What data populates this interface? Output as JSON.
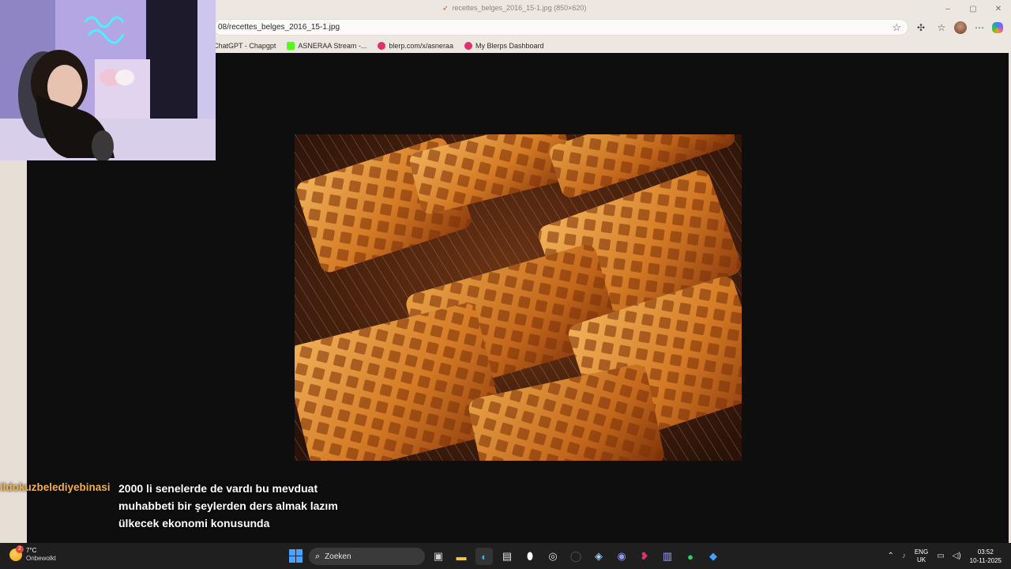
{
  "window": {
    "title": "recettes_belges_2016_15-1.jpg (850×620)",
    "controls": [
      "–",
      "▢",
      "✕"
    ]
  },
  "address_bar": {
    "url": "08/recettes_belges_2016_15-1.jpg"
  },
  "bookmarks": [
    {
      "label": "ChatGPT - Chapgpt",
      "icon": "none",
      "color": ""
    },
    {
      "label": "ASNERAA Stream -...",
      "icon": "kick-icon",
      "color": "#53fc18"
    },
    {
      "label": "blerp.com/x/asneraa",
      "icon": "blerp-icon",
      "color": "#e0306d"
    },
    {
      "label": "My Blerps Dashboard",
      "icon": "blerp-icon",
      "color": "#e0306d"
    }
  ],
  "viewer": {
    "image_subject": "Belgian waffles on a cooling rack",
    "background": "#0e0e0e"
  },
  "chat": {
    "username": "ildokuzbelediyebinasi",
    "username_color": "#f3b04a",
    "message": "2000 li senelerde de vardı bu mevduat muhabbeti bir şeylerden ders almak lazım ülkecek ekonomi konusunda"
  },
  "taskbar": {
    "weather_temp": "7°C",
    "weather_desc": "Onbewolkt",
    "weather_badge": "2",
    "search_placeholder": "Zoeken",
    "apps": [
      "task-view-icon",
      "file-explorer-icon",
      "edge-icon",
      "store-icon",
      "alienware-icon",
      "obs-icon",
      "app-icon",
      "steam-icon",
      "discord-icon",
      "blerp-icon",
      "app-icon-2",
      "spotify-icon",
      "app-icon-3"
    ],
    "lang_top": "ENG",
    "lang_bottom": "UK",
    "time": "03:52",
    "date": "10-11-2025"
  }
}
